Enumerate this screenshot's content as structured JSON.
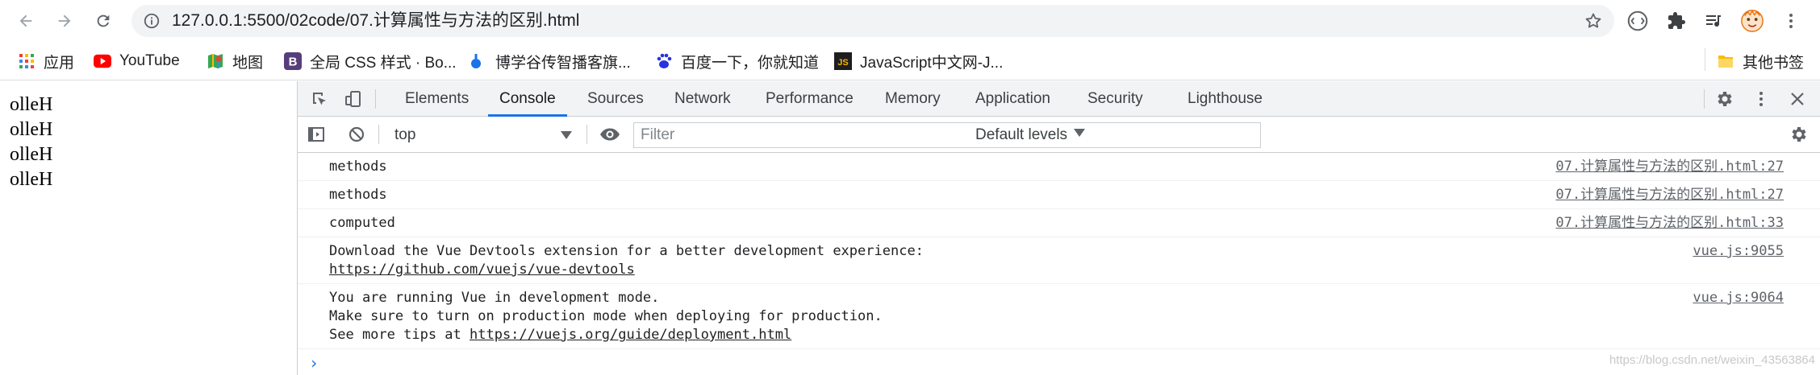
{
  "browser": {
    "url": "127.0.0.1:5500/02code/07.计算属性与方法的区别.html",
    "bookmarks": [
      {
        "label": "应用",
        "icon": "apps-grid-icon"
      },
      {
        "label": "YouTube",
        "icon": "youtube-icon"
      },
      {
        "label": "地图",
        "icon": "maps-icon"
      },
      {
        "label": "全局 CSS 样式 · Bo...",
        "icon": "bootstrap-icon"
      },
      {
        "label": "博学谷传智播客旗...",
        "icon": "boxuegu-icon"
      },
      {
        "label": "百度一下，你就知道",
        "icon": "baidu-icon"
      },
      {
        "label": "JavaScript中文网-J...",
        "icon": "js-icon"
      }
    ],
    "other_bookmarks": "其他书签"
  },
  "page": {
    "lines": [
      "olleH",
      "olleH",
      "olleH",
      "olleH"
    ]
  },
  "devtools": {
    "tabs": [
      "Elements",
      "Console",
      "Sources",
      "Network",
      "Performance",
      "Memory",
      "Application",
      "Security",
      "Lighthouse"
    ],
    "active_tab": "Console",
    "context": "top",
    "filter_placeholder": "Filter",
    "levels": "Default levels",
    "messages": [
      {
        "lines": [
          "methods"
        ],
        "source": "07.计算属性与方法的区别.html:27"
      },
      {
        "lines": [
          "methods"
        ],
        "source": "07.计算属性与方法的区别.html:27"
      },
      {
        "lines": [
          "computed"
        ],
        "source": "07.计算属性与方法的区别.html:33"
      },
      {
        "lines": [
          "Download the Vue Devtools extension for a better development experience:"
        ],
        "link": "https://github.com/vuejs/vue-devtools",
        "source": "vue.js:9055"
      },
      {
        "lines": [
          "You are running Vue in development mode.",
          "Make sure to turn on production mode when deploying for production."
        ],
        "prefix": "See more tips at ",
        "link": "https://vuejs.org/guide/deployment.html",
        "source": "vue.js:9064"
      }
    ],
    "prompt": "›"
  },
  "watermark": "https://blog.csdn.net/weixin_43563864",
  "colors": {
    "accent": "#1a73e8",
    "youtube": "#ff0000",
    "bootstrap": "#563d7c",
    "baidu": "#2932e1",
    "js": "#1e1e1e"
  }
}
